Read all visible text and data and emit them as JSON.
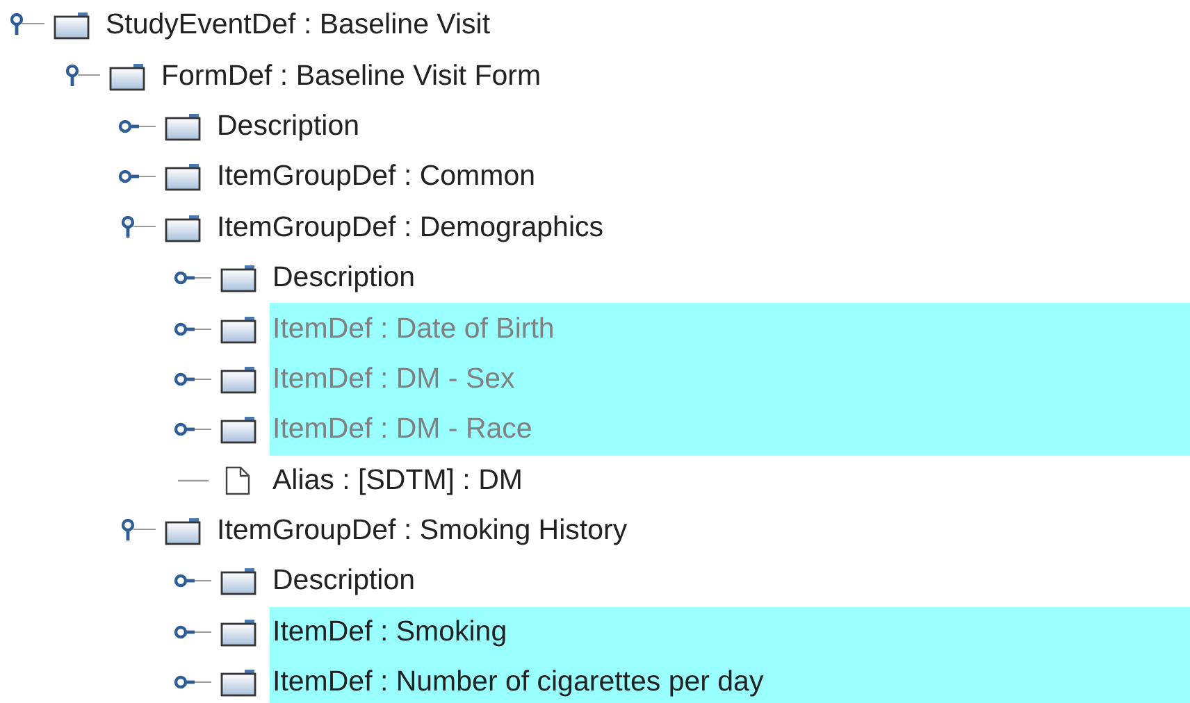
{
  "tree": [
    {
      "label": "StudyEventDef : Baseline Visit",
      "kind": "folder",
      "expanded": true,
      "highlighted": false,
      "greyed": false,
      "children": [
        {
          "label": "FormDef : Baseline Visit Form",
          "kind": "folder",
          "expanded": true,
          "highlighted": false,
          "greyed": false,
          "children": [
            {
              "label": "Description",
              "kind": "folder",
              "expanded": false,
              "highlighted": false,
              "greyed": false
            },
            {
              "label": "ItemGroupDef : Common",
              "kind": "folder",
              "expanded": false,
              "highlighted": false,
              "greyed": false
            },
            {
              "label": "ItemGroupDef : Demographics",
              "kind": "folder",
              "expanded": true,
              "highlighted": false,
              "greyed": false,
              "children": [
                {
                  "label": "Description",
                  "kind": "folder",
                  "expanded": false,
                  "highlighted": false,
                  "greyed": false
                },
                {
                  "label": "ItemDef : Date of Birth",
                  "kind": "folder",
                  "expanded": false,
                  "highlighted": true,
                  "greyed": true
                },
                {
                  "label": "ItemDef : DM - Sex",
                  "kind": "folder",
                  "expanded": false,
                  "highlighted": true,
                  "greyed": true
                },
                {
                  "label": "ItemDef : DM - Race",
                  "kind": "folder",
                  "expanded": false,
                  "highlighted": true,
                  "greyed": true
                },
                {
                  "label": "Alias : [SDTM] : DM",
                  "kind": "file",
                  "highlighted": false,
                  "greyed": false
                }
              ]
            },
            {
              "label": "ItemGroupDef : Smoking History",
              "kind": "folder",
              "expanded": true,
              "highlighted": false,
              "greyed": false,
              "children": [
                {
                  "label": "Description",
                  "kind": "folder",
                  "expanded": false,
                  "highlighted": false,
                  "greyed": false
                },
                {
                  "label": "ItemDef : Smoking",
                  "kind": "folder",
                  "expanded": false,
                  "highlighted": true,
                  "greyed": false
                },
                {
                  "label": "ItemDef : Number of cigarettes per day",
                  "kind": "folder",
                  "expanded": false,
                  "highlighted": true,
                  "greyed": false
                }
              ]
            }
          ]
        }
      ]
    }
  ]
}
